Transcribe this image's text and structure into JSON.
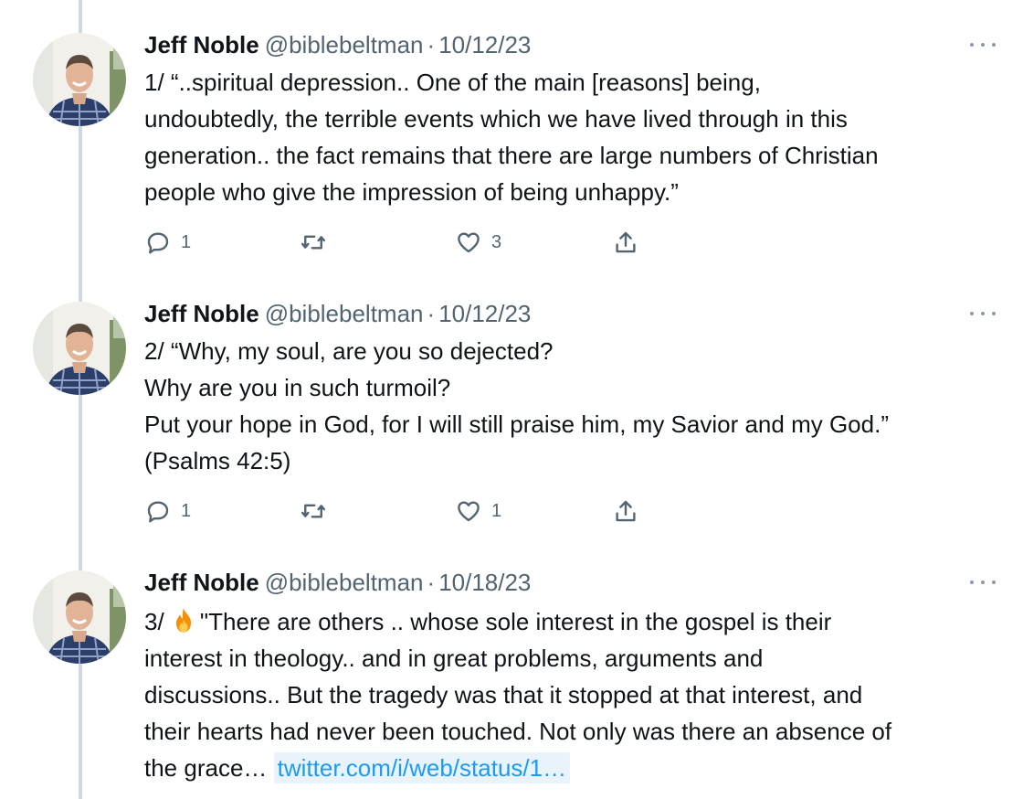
{
  "tweets": [
    {
      "author": "Jeff Noble",
      "handle": "@biblebeltman",
      "separator": "·",
      "date": "10/12/23",
      "lines": [
        "1/ “..spiritual depression.. One of the main [reasons] being,",
        "undoubtedly, the terrible events which we have lived through in this",
        "generation.. the fact remains that there are large numbers of Christian",
        "people who give the impression of being unhappy.”"
      ],
      "replies": "1",
      "retweets": "",
      "likes": "3"
    },
    {
      "author": "Jeff Noble",
      "handle": "@biblebeltman",
      "separator": "·",
      "date": "10/12/23",
      "lines": [
        "2/ “Why, my soul, are you so dejected?",
        "Why are you in such turmoil?",
        "Put your hope in God, for I will still praise him, my Savior and my God.”",
        "(Psalms 42:5)"
      ],
      "replies": "1",
      "retweets": "",
      "likes": "1"
    },
    {
      "author": "Jeff Noble",
      "handle": "@biblebeltman",
      "separator": "·",
      "date": "10/18/23",
      "prefix": "3/",
      "emoji": "fire-emoji",
      "lines": [
        "\"There are others .. whose sole interest in the gospel is their",
        "interest in theology.. and in great problems, arguments and",
        "discussions.. But the tragedy was that it stopped at that interest, and",
        "their hearts had never been touched. Not only was there an absence of",
        "the grace…"
      ],
      "link": "twitter.com/i/web/status/1…"
    }
  ],
  "icons": {
    "reply": "reply-icon",
    "retweet": "retweet-icon",
    "like": "heart-icon",
    "share": "share-icon",
    "more": "more-icon"
  },
  "colors": {
    "text": "#0f1419",
    "muted": "#536471",
    "link": "#1d9bf0",
    "thread_line": "#cfd9de"
  }
}
